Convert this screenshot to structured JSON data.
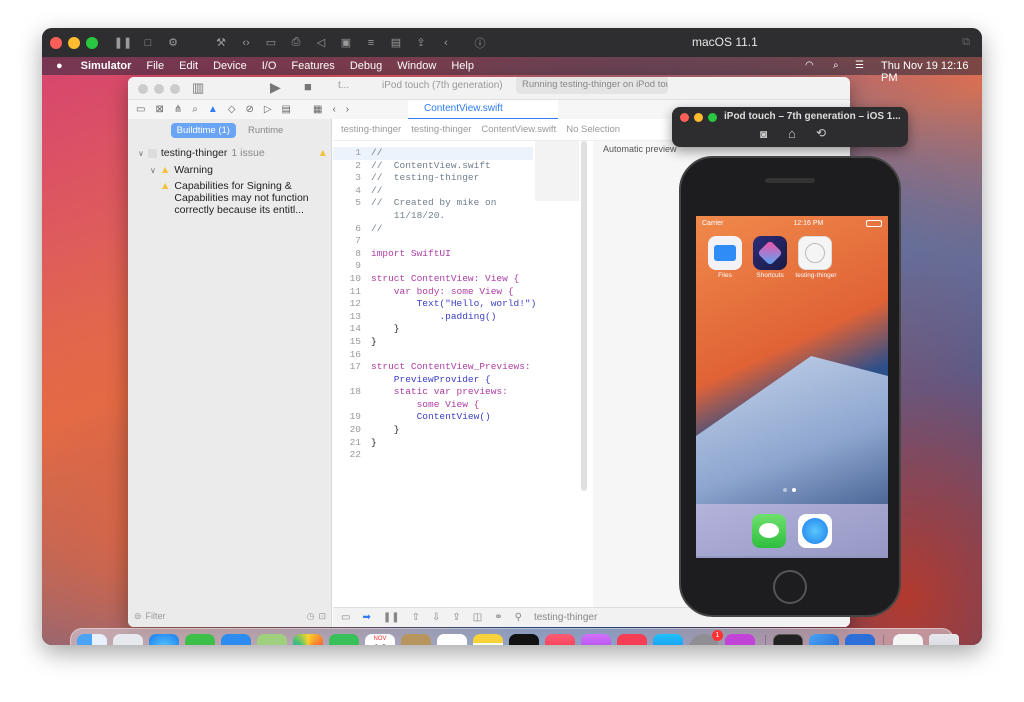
{
  "vm": {
    "title": "macOS 11.1"
  },
  "menubar": {
    "app": "Simulator",
    "items": [
      "File",
      "Edit",
      "Device",
      "I/O",
      "Features",
      "Debug",
      "Window",
      "Help"
    ],
    "datetime": "Thu Nov 19  12:16 PM"
  },
  "xcode": {
    "scheme_crumb": "t...",
    "device": "iPod touch (7th generation)",
    "status": "Running testing-thinger on iPod touch",
    "tabs": {
      "buildtime": "Buildtime (1)",
      "runtime": "Runtime"
    },
    "issue_project": "testing-thinger",
    "issue_count": "1 issue",
    "warning_label": "Warning",
    "warning_text": "Capabilities for Signing & Capabilities may not function correctly because its entitl...",
    "file_tab": "ContentView.swift",
    "jump": [
      "testing-thinger",
      "testing-thinger",
      "ContentView.swift",
      "No Selection"
    ],
    "filter_placeholder": "Filter",
    "canvas_label": "Automatic preview",
    "debug_target": "testing-thinger"
  },
  "code_lines": [
    {
      "n": "1",
      "t": "//",
      "c": "cm"
    },
    {
      "n": "2",
      "t": "//  ContentView.swift",
      "c": "cm"
    },
    {
      "n": "3",
      "t": "//  testing-thinger",
      "c": "cm"
    },
    {
      "n": "4",
      "t": "//",
      "c": "cm"
    },
    {
      "n": "5",
      "t": "//  Created by mike on",
      "c": "cm"
    },
    {
      "n": "",
      "t": "    11/18/20.",
      "c": "cm"
    },
    {
      "n": "6",
      "t": "//",
      "c": "cm"
    },
    {
      "n": "7",
      "t": "",
      "c": ""
    },
    {
      "n": "8",
      "t": "import SwiftUI",
      "c": "kw"
    },
    {
      "n": "9",
      "t": "",
      "c": ""
    },
    {
      "n": "10",
      "t": "struct ContentView: View {",
      "c": "kw"
    },
    {
      "n": "11",
      "t": "    var body: some View {",
      "c": "kw"
    },
    {
      "n": "12",
      "t": "        Text(\"Hello, world!\")",
      "c": "ty"
    },
    {
      "n": "13",
      "t": "            .padding()",
      "c": "ty"
    },
    {
      "n": "14",
      "t": "    }",
      "c": ""
    },
    {
      "n": "15",
      "t": "}",
      "c": ""
    },
    {
      "n": "16",
      "t": "",
      "c": ""
    },
    {
      "n": "17",
      "t": "struct ContentView_Previews:",
      "c": "kw"
    },
    {
      "n": "",
      "t": "    PreviewProvider {",
      "c": "ty"
    },
    {
      "n": "18",
      "t": "    static var previews:",
      "c": "kw"
    },
    {
      "n": "",
      "t": "        some View {",
      "c": "kw"
    },
    {
      "n": "19",
      "t": "        ContentView()",
      "c": "ty"
    },
    {
      "n": "20",
      "t": "    }",
      "c": ""
    },
    {
      "n": "21",
      "t": "}",
      "c": ""
    },
    {
      "n": "22",
      "t": "",
      "c": ""
    }
  ],
  "simulator": {
    "title": "iPod touch – 7th generation – iOS 1...",
    "carrier": "Carrier",
    "time": "12:16 PM",
    "apps": [
      "Files",
      "Shortcuts",
      "testing-thinger"
    ]
  },
  "dock": {
    "calendar_month": "NOV",
    "calendar_day": "19",
    "tv_label": "tv",
    "badge": "1"
  },
  "colors": {
    "accent": "#2f7cf6",
    "warning": "#f5c33b"
  }
}
